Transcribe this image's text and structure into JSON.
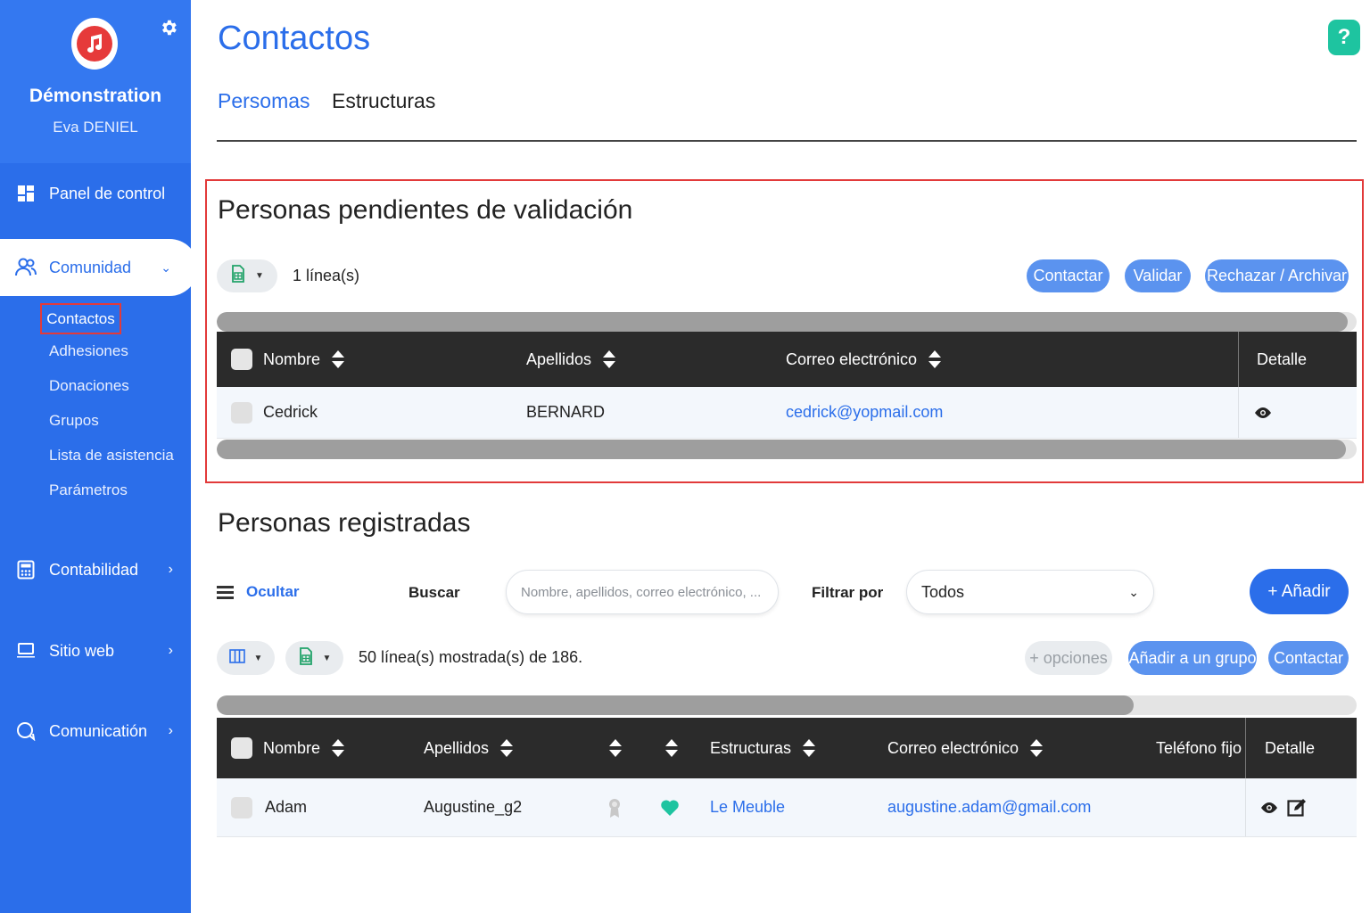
{
  "sidebar": {
    "org_name": "Démonstration",
    "user_name": "Eva DENIEL",
    "items": [
      {
        "label": "Panel de control",
        "icon": "dashboard-icon"
      },
      {
        "label": "Comunidad",
        "icon": "community-icon"
      },
      {
        "label": "Contabilidad",
        "icon": "calculator-icon"
      },
      {
        "label": "Sitio web",
        "icon": "laptop-icon"
      },
      {
        "label": "Comunicatión",
        "icon": "chat-icon"
      }
    ],
    "sub_items": [
      "Contactos",
      "Adhesiones",
      "Donaciones",
      "Grupos",
      "Lista de asistencia",
      "Parámetros"
    ]
  },
  "header": {
    "title": "Contactos",
    "help": "?",
    "tabs": [
      "Persomas",
      "Estructuras"
    ]
  },
  "pending": {
    "title": "Personas pendientes de validación",
    "row_count": "1 línea(s)",
    "buttons": {
      "contact": "Contactar",
      "validate": "Validar",
      "reject": "Rechazar / Archivar"
    },
    "columns": [
      "Nombre",
      "Apellidos",
      "Correo electrónico",
      "Detalle"
    ],
    "rows": [
      {
        "nombre": "Cedrick",
        "apellidos": "BERNARD",
        "correo": "cedrick@yopmail.com"
      }
    ]
  },
  "registered": {
    "title": "Personas registradas",
    "hide_label": "Ocultar",
    "search_label": "Buscar",
    "search_placeholder": "Nombre, apellidos, correo electrónico, ...",
    "filter_label": "Filtrar por",
    "filter_value": "Todos",
    "add_button": "+ Añadir",
    "row_count": "50 línea(s) mostrada(s) de 186.",
    "options_button": "+ opciones",
    "add_group_button": "Añadir a un grupo",
    "contact_button": "Contactar",
    "columns": [
      "Nombre",
      "Apellidos",
      "Estructuras",
      "Correo electrónico",
      "Teléfono fijo",
      "Detalle"
    ],
    "rows": [
      {
        "nombre": "Adam",
        "apellidos": "Augustine_g2",
        "estructura": "Le Meuble",
        "correo": "augustine.adam@gmail.com",
        "telefono": ""
      }
    ]
  },
  "colors": {
    "primary": "#2b6eea",
    "sidebar": "#2b6eea",
    "accent": "#1ec4a0",
    "highlight": "#e23a3a"
  }
}
